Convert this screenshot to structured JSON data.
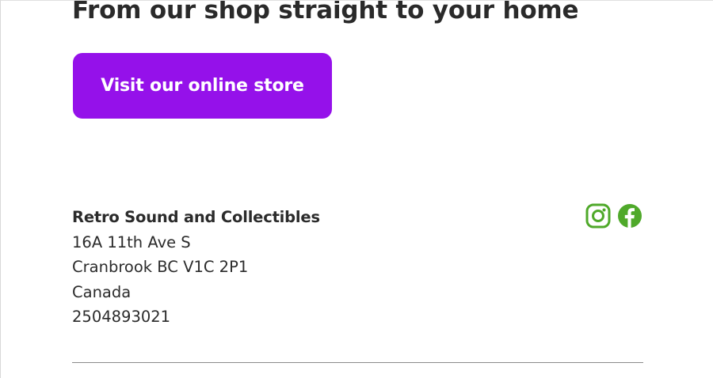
{
  "hero": {
    "headline": "From our shop straight to your home",
    "cta_label": "Visit our online store",
    "cta_color": "#9511ea"
  },
  "footer": {
    "business_name": "Retro Sound and Collectibles",
    "address_line1": "16A 11th Ave S",
    "address_line2": "Cranbrook BC V1C 2P1",
    "country": "Canada",
    "phone": "2504893021",
    "social_icon_color": "#4fa92a",
    "social": [
      {
        "icon": "instagram-icon"
      },
      {
        "icon": "facebook-icon"
      }
    ]
  }
}
